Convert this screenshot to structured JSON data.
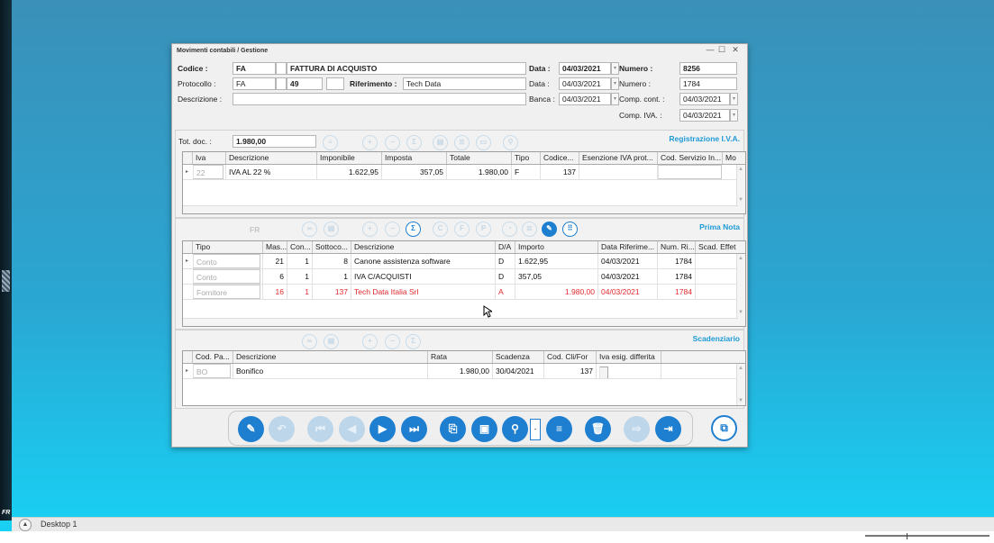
{
  "desktop": {
    "taskbar_label": "Desktop 1",
    "strip_label": "FR"
  },
  "window": {
    "title": "Movimenti contabili / Gestione",
    "minimize": "—",
    "maximize": "☐",
    "close": "✕"
  },
  "header": {
    "codice_label": "Codice :",
    "codice_value": "FA",
    "codice_desc": "FATTURA DI ACQUISTO",
    "data_label": "Data :",
    "data_value": "04/03/2021",
    "numero_label": "Numero :",
    "numero_value": "8256",
    "protocollo_label": "Protocollo :",
    "protocollo_value": "FA",
    "protocollo_num": "49",
    "riferimento_label": "Riferimento :",
    "riferimento_value": "Tech Data",
    "data2_label": "Data :",
    "data2_value": "04/03/2021",
    "numero2_label": "Numero :",
    "numero2_value": "1784",
    "descrizione_label": "Descrizione :",
    "descrizione_value": "",
    "banca_label": "Banca :",
    "banca_value": "04/03/2021",
    "comp_cont_label": "Comp. cont. :",
    "comp_cont_value": "04/03/2021",
    "comp_iva_label": "Comp. IVA. :",
    "comp_iva_value": "04/03/2021"
  },
  "iva_section": {
    "tot_doc_label": "Tot. doc. :",
    "tot_doc_value": "1.980,00",
    "title": "Registrazione I.V.A.",
    "columns": [
      "Iva",
      "Descrizione",
      "Imponibile",
      "Imposta",
      "Totale",
      "Tipo",
      "Codice...",
      "Esenzione IVA prot...",
      "Cod. Servizio In...",
      "Mo"
    ],
    "rows": [
      {
        "iva": "22",
        "descrizione": "IVA AL 22 %",
        "imponibile": "1.622,95",
        "imposta": "357,05",
        "totale": "1.980,00",
        "tipo": "F",
        "codice": "137",
        "esenzione": "",
        "cod_servizio": ""
      }
    ]
  },
  "prima_nota": {
    "title": "Prima Nota",
    "fr_label": "FR",
    "columns": [
      "Tipo",
      "Mas...",
      "Con...",
      "Sottoco...",
      "Descrizione",
      "D/A",
      "Importo",
      "Data Riferime...",
      "Num. Ri...",
      "Scad. Effet"
    ],
    "rows": [
      {
        "tipo": "Conto",
        "mas": "21",
        "con": "1",
        "sottoconto": "8",
        "descrizione": "Canone assistenza software",
        "da": "D",
        "importo": "1.622,95",
        "data_rif": "04/03/2021",
        "num_rif": "1784"
      },
      {
        "tipo": "Conto",
        "mas": "6",
        "con": "1",
        "sottoconto": "1",
        "descrizione": "IVA C/ACQUISTI",
        "da": "D",
        "importo": "357,05",
        "data_rif": "04/03/2021",
        "num_rif": "1784"
      },
      {
        "tipo": "Fornitore",
        "mas": "16",
        "con": "1",
        "sottoconto": "137",
        "descrizione": "Tech Data Italia Srl",
        "da": "A",
        "importo": "1.980,00",
        "data_rif": "04/03/2021",
        "num_rif": "1784"
      }
    ]
  },
  "scadenziario": {
    "title": "Scadenziario",
    "columns": [
      "Cod. Pa...",
      "Descrizione",
      "Rata",
      "Scadenza",
      "Cod. Cli/For",
      "Iva esig. differita"
    ],
    "rows": [
      {
        "cod_pag": "BO",
        "descrizione": "Bonifico",
        "rata": "1.980,00",
        "scadenza": "30/04/2021",
        "cod_cli": "137",
        "iva_esig": false
      }
    ]
  },
  "colors": {
    "accent": "#1e7fd0",
    "section_title": "#1e9bd7",
    "error_row": "#e2282c"
  },
  "toolbar_icons": [
    "edit-icon",
    "undo-icon",
    "first-icon",
    "prev-icon",
    "next-icon",
    "last-icon",
    "new-doc-icon",
    "save-icon",
    "search-icon",
    "list-icon",
    "delete-icon",
    "export-icon",
    "exit-icon",
    "open-window-icon"
  ]
}
